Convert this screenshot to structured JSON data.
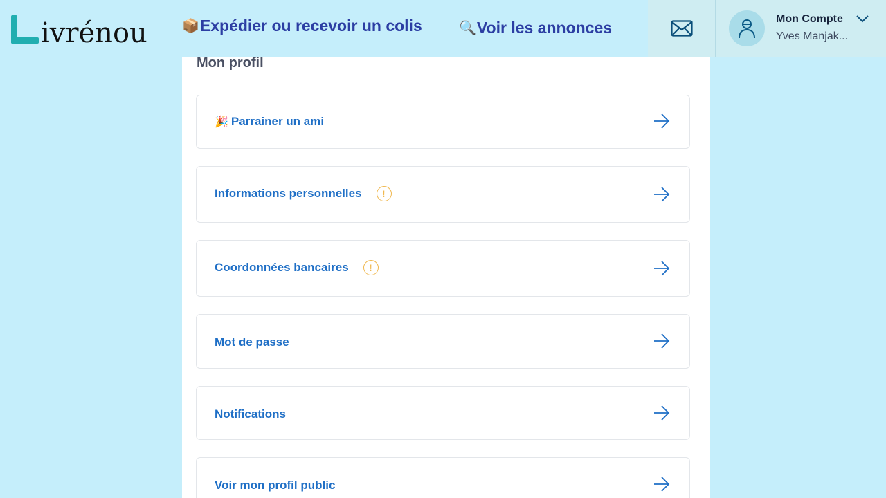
{
  "header": {
    "logo_text": "ivrénou",
    "nav": [
      {
        "emoji": "📦",
        "label": "Expédier ou recevoir un colis"
      },
      {
        "emoji": "🔍",
        "label": "Voir les annonces"
      }
    ],
    "account": {
      "title": "Mon Compte",
      "name": "Yves Manjak..."
    }
  },
  "profile": {
    "title": "Mon profil",
    "items": [
      {
        "emoji": "🎉",
        "label": "Parrainer un ami",
        "warning": false
      },
      {
        "label": "Informations personnelles",
        "warning": true,
        "warning_glyph": "!"
      },
      {
        "label": "Coordonnées bancaires",
        "warning": true,
        "warning_glyph": "!"
      },
      {
        "label": "Mot de passe",
        "warning": false
      },
      {
        "label": "Notifications",
        "warning": false
      },
      {
        "label": "Voir mon profil public",
        "warning": false
      }
    ]
  },
  "colors": {
    "background": "#c5eefb",
    "logo_accent": "#21aeb0",
    "nav_text": "#2c3ea3",
    "link_blue": "#1f6fc6",
    "warning": "#f0b84f"
  },
  "icons": {
    "mail": "mail-icon",
    "avatar": "user-icon",
    "chevron": "chevron-down-icon",
    "row_arrow": "arrow-right-icon",
    "warning": "warning-circle-icon"
  }
}
